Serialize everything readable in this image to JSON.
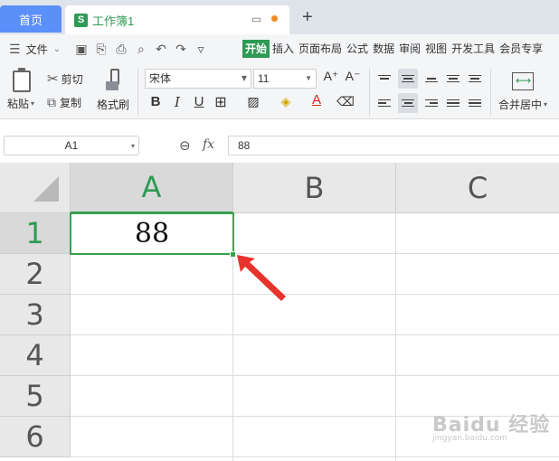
{
  "tabs": {
    "home": "首页",
    "doc_icon_letter": "S",
    "doc_name": "工作簿1",
    "add": "+"
  },
  "menubar": {
    "file_label": "文件",
    "ribbon_tabs": [
      "开始",
      "插入",
      "页面布局",
      "公式",
      "数据",
      "审阅",
      "视图",
      "开发工具",
      "会员专享"
    ],
    "active_tab": "开始"
  },
  "toolbar": {
    "paste": "粘贴",
    "cut": "剪切",
    "copy": "复制",
    "format_painter": "格式刷",
    "font_name": "宋体",
    "font_size": "11",
    "bold": "B",
    "italic": "I",
    "underline": "U",
    "merge_center": "合并居中"
  },
  "formula_bar": {
    "cell_ref": "A1",
    "fx": "fx",
    "value": "88"
  },
  "grid": {
    "columns": [
      "A",
      "B",
      "C"
    ],
    "rows": [
      "1",
      "2",
      "3",
      "4",
      "5",
      "6"
    ],
    "selected_cell": "A1",
    "cells": {
      "A1": "88"
    }
  },
  "colors": {
    "accent_green": "#2e9b54",
    "home_tab_blue": "#5b8ff9",
    "arrow_red": "#e8322c"
  },
  "watermark": {
    "brand": "Baidu 经验",
    "url": "jingyan.baidu.com"
  }
}
